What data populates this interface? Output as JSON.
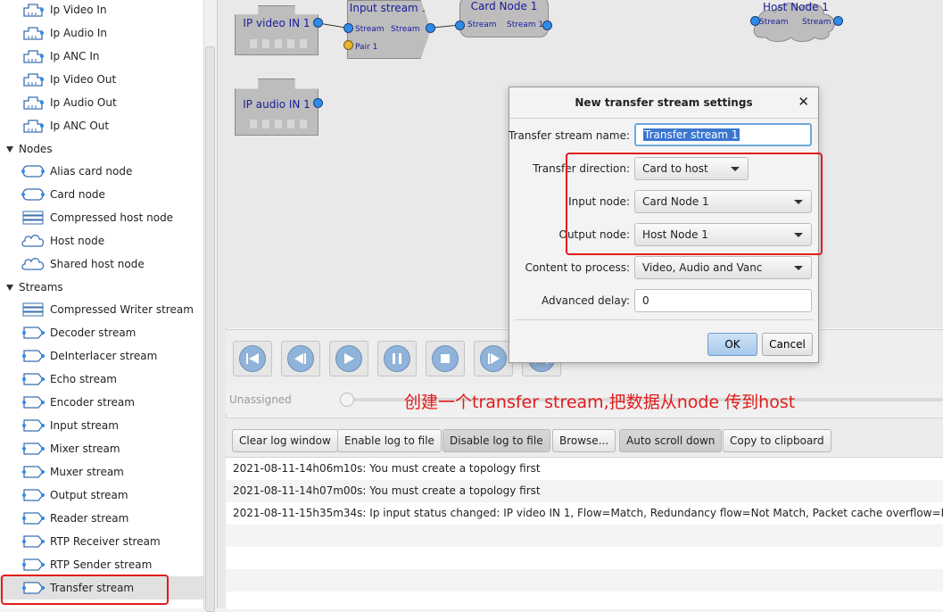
{
  "sidebar": {
    "io_items": [
      "Ip Video In",
      "Ip Audio In",
      "Ip ANC In",
      "Ip Video Out",
      "Ip Audio Out",
      "Ip ANC Out"
    ],
    "nodes_group": "Nodes",
    "node_items": [
      "Alias card node",
      "Card node",
      "Compressed host node",
      "Host node",
      "Shared host node"
    ],
    "streams_group": "Streams",
    "stream_items": [
      "Compressed Writer stream",
      "Decoder stream",
      "DeInterlacer stream",
      "Echo stream",
      "Encoder stream",
      "Input stream",
      "Mixer stream",
      "Muxer stream",
      "Output stream",
      "Reader stream",
      "RTP Receiver stream",
      "RTP Sender stream",
      "Transfer stream"
    ],
    "selected": "Transfer stream"
  },
  "canvas": {
    "ip_video_in": "IP video IN 1",
    "ip_audio_in": "IP audio IN 1",
    "input_stream": {
      "title": "Input stream 1",
      "port_in": "Stream",
      "port_out": "Stream",
      "pair": "Pair 1"
    },
    "card_node": {
      "title": "Card Node 1",
      "port_in": "Stream",
      "port_out": "Stream 1"
    },
    "host_node": {
      "title": "Host Node 1",
      "port_in": "Stream",
      "port_out": "Stream 1"
    }
  },
  "player": {
    "unassigned": "Unassigned"
  },
  "annotation": "创建一个transfer stream,把数据从node 传到host",
  "log_toolbar": {
    "clear": "Clear log window",
    "enable": "Enable log to file",
    "disable": "Disable log to file",
    "browse": "Browse...",
    "autoscroll": "Auto scroll down",
    "copy": "Copy to clipboard"
  },
  "log_lines": [
    "2021-08-11-14h06m10s: You must create a topology first",
    "2021-08-11-14h07m00s: You must create a topology first",
    "2021-08-11-15h35m34s: Ip input status changed: IP video IN 1, Flow=Match, Redundancy flow=Not Match, Packet cache overflow=Not Ove"
  ],
  "dialog": {
    "title": "New transfer stream settings",
    "close": "✕",
    "name_label": "Transfer stream name:",
    "name_value": "Transfer stream 1",
    "direction_label": "Transfer direction:",
    "direction_value": "Card to host",
    "input_label": "Input node:",
    "input_value": "Card Node 1",
    "output_label": "Output node:",
    "output_value": "Host Node 1",
    "content_label": "Content to process:",
    "content_value": "Video, Audio and Vanc",
    "delay_label": "Advanced delay:",
    "delay_value": "0",
    "ok": "OK",
    "cancel": "Cancel"
  },
  "colors": {
    "accent_red": "#e21b1b",
    "port_blue": "#2f8be8",
    "node_text": "#1a1a9a"
  }
}
